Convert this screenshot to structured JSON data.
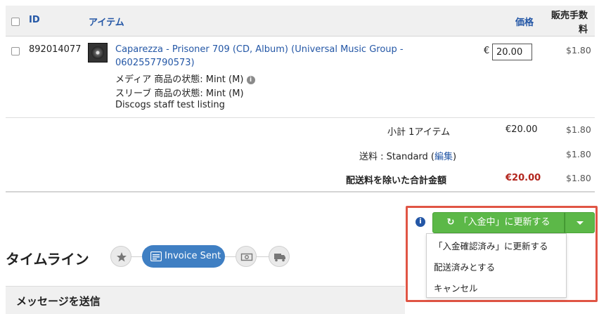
{
  "table": {
    "headers": {
      "id": "ID",
      "item": "アイテム",
      "price": "価格",
      "fee_line1": "販売手数",
      "fee_line2": "料"
    },
    "rows": [
      {
        "id": "892014077",
        "title_line1": "Caparezza - Prisoner 709 (CD, Album) (Universal Music Group -",
        "title_line2": "0602557790573)",
        "media_condition": "メディア 商品の状態: Mint (M)",
        "sleeve_condition": "スリーブ 商品の状態: Mint (M)",
        "comment": "Discogs staff test listing",
        "currency_symbol": "€",
        "price_value": "20.00",
        "fee": "$1.80"
      }
    ],
    "info_glyph": "i"
  },
  "summary": {
    "subtotal_label": "小計 1アイテム",
    "subtotal_value": "€20.00",
    "subtotal_fee": "$1.80",
    "shipping_label_prefix": "送料 : Standard (",
    "shipping_edit_link": "編集",
    "shipping_label_suffix": ")",
    "shipping_fee": "$1.80",
    "total_label": "配送料を除いた合計金額",
    "total_value": "€20.00",
    "total_fee": "$1.80"
  },
  "status_action": {
    "info_glyph": "i",
    "refresh_icon": "↻",
    "primary_button": "「入金中」に更新する",
    "menu_items": [
      "「入金確認済み」に更新する",
      "配送済みとする",
      "キャンセル"
    ]
  },
  "timeline": {
    "title": "タイムライン",
    "active_step": "Invoice Sent",
    "icons": [
      "star-icon",
      "invoice-icon",
      "cash-icon",
      "truck-icon"
    ]
  },
  "message": {
    "title": "メッセージを送信"
  },
  "colors": {
    "link": "#2457a6",
    "total_red": "#b3261e",
    "button_green": "#5cb848",
    "highlight_border": "#e05545",
    "timeline_active": "#3f7fc3"
  }
}
